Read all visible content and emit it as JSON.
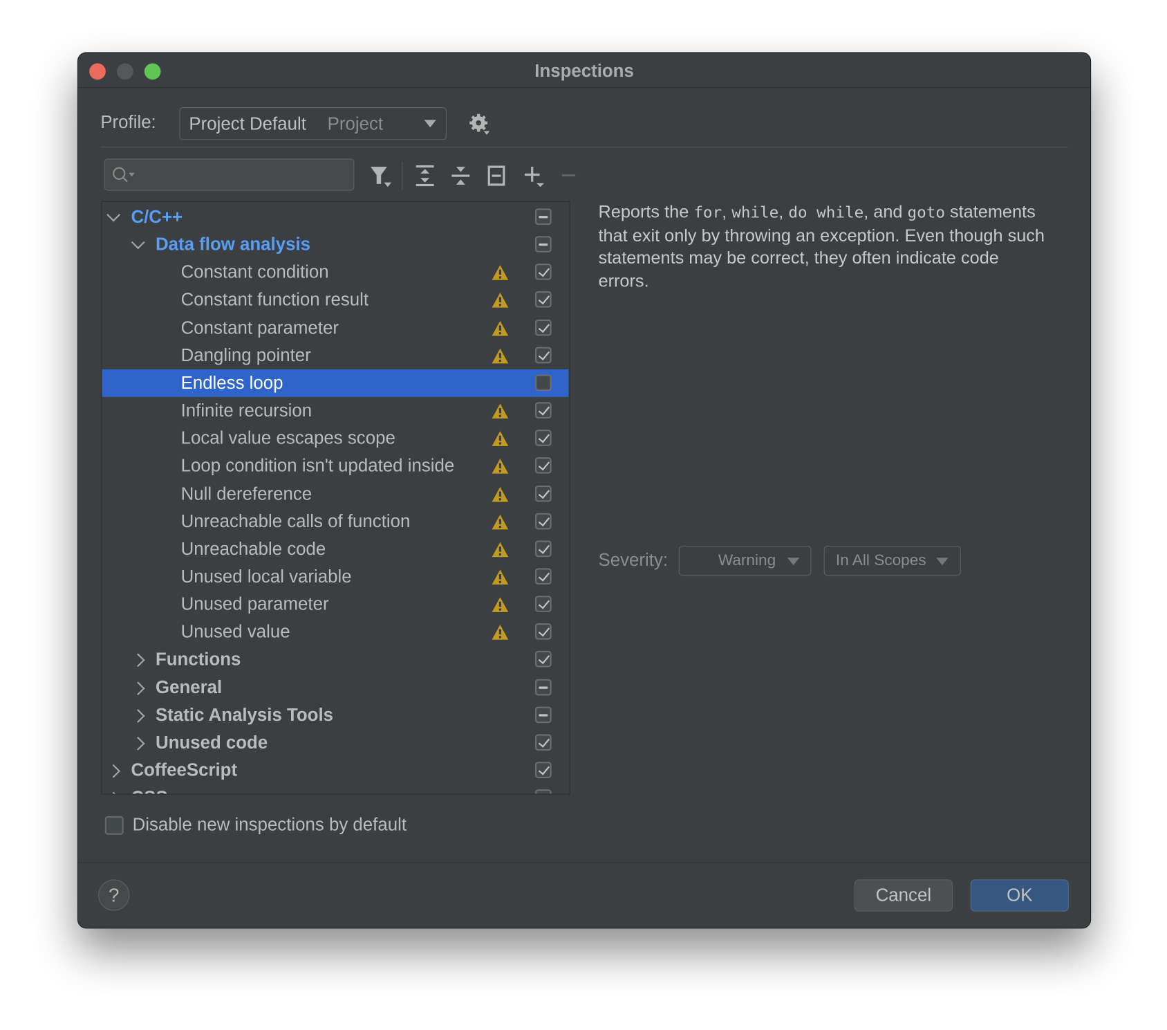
{
  "window": {
    "title": "Inspections"
  },
  "colors": {
    "accent": "#2f65ca",
    "link_blue": "#589df6",
    "warning": "#c69a1c",
    "ok_button": "#365880",
    "close": "#ed6a5e",
    "minimize": "#55585a",
    "zoom": "#61c554"
  },
  "profile": {
    "label": "Profile:",
    "value": "Project Default",
    "scope": "Project"
  },
  "toolbar": {
    "icons": [
      "filter-icon",
      "expand-all-icon",
      "collapse-all-icon",
      "reset-icon",
      "add-icon",
      "remove-icon"
    ]
  },
  "search": {
    "placeholder": ""
  },
  "tree": [
    {
      "label": "C/C++",
      "level": 0,
      "expanded": true,
      "state": "mixed",
      "warning": false,
      "highlight": true
    },
    {
      "label": "Data flow analysis",
      "level": 1,
      "expanded": true,
      "state": "mixed",
      "warning": false,
      "highlight": true
    },
    {
      "label": "Constant condition",
      "level": 2,
      "state": "checked",
      "warning": true
    },
    {
      "label": "Constant function result",
      "level": 2,
      "state": "checked",
      "warning": true
    },
    {
      "label": "Constant parameter",
      "level": 2,
      "state": "checked",
      "warning": true
    },
    {
      "label": "Dangling pointer",
      "level": 2,
      "state": "checked",
      "warning": true
    },
    {
      "label": "Endless loop",
      "level": 2,
      "state": "unchecked",
      "warning": false,
      "selected": true
    },
    {
      "label": "Infinite recursion",
      "level": 2,
      "state": "checked",
      "warning": true
    },
    {
      "label": "Local value escapes scope",
      "level": 2,
      "state": "checked",
      "warning": true
    },
    {
      "label": "Loop condition isn't updated inside",
      "level": 2,
      "state": "checked",
      "warning": true
    },
    {
      "label": "Null dereference",
      "level": 2,
      "state": "checked",
      "warning": true
    },
    {
      "label": "Unreachable calls of function",
      "level": 2,
      "state": "checked",
      "warning": true
    },
    {
      "label": "Unreachable code",
      "level": 2,
      "state": "checked",
      "warning": true
    },
    {
      "label": "Unused local variable",
      "level": 2,
      "state": "checked",
      "warning": true
    },
    {
      "label": "Unused parameter",
      "level": 2,
      "state": "checked",
      "warning": true
    },
    {
      "label": "Unused value",
      "level": 2,
      "state": "checked",
      "warning": true
    },
    {
      "label": "Functions",
      "level": 1,
      "expanded": false,
      "state": "checked",
      "warning": false
    },
    {
      "label": "General",
      "level": 1,
      "expanded": false,
      "state": "mixed",
      "warning": false
    },
    {
      "label": "Static Analysis Tools",
      "level": 1,
      "expanded": false,
      "state": "mixed",
      "warning": false
    },
    {
      "label": "Unused code",
      "level": 1,
      "expanded": false,
      "state": "checked",
      "warning": false
    },
    {
      "label": "CoffeeScript",
      "level": 0,
      "expanded": false,
      "state": "checked",
      "warning": false
    },
    {
      "label": "CSS",
      "level": 0,
      "expanded": false,
      "state": "checked",
      "warning": false
    }
  ],
  "description": [
    {
      "text": "Reports the ",
      "mono": false
    },
    {
      "text": "for",
      "mono": true
    },
    {
      "text": ", ",
      "mono": false
    },
    {
      "text": "while",
      "mono": true
    },
    {
      "text": ", ",
      "mono": false
    },
    {
      "text": "do while",
      "mono": true
    },
    {
      "text": ", and ",
      "mono": false
    },
    {
      "text": "goto",
      "mono": true
    },
    {
      "text": " statements that exit only by throwing an exception. Even though such statements may be correct, they often indicate code errors.",
      "mono": false
    }
  ],
  "severity": {
    "label": "Severity:",
    "value": "Warning",
    "scope": "In All Scopes"
  },
  "disable_new": {
    "label": "Disable new inspections by default",
    "checked": false
  },
  "buttons": {
    "help": "?",
    "cancel": "Cancel",
    "ok": "OK"
  }
}
